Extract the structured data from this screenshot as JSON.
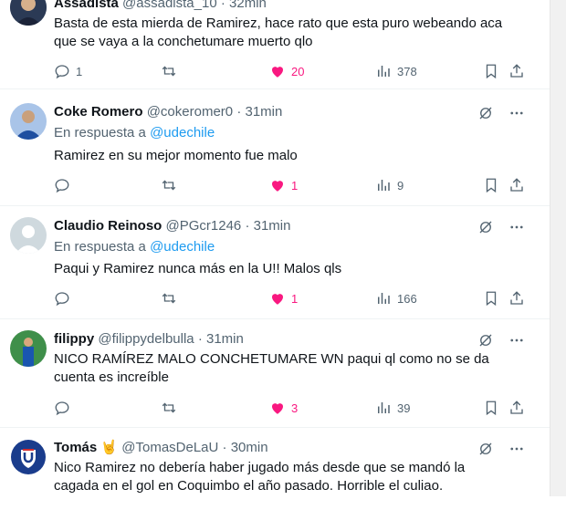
{
  "tweets": [
    {
      "name": "Assadista",
      "handle": "@assadista_10",
      "time": "32min",
      "reply_prefix": "",
      "reply_to": "",
      "text": "Basta de esta mierda de Ramirez, hace rato que esta puro webeando aca que se vaya a la conchetumare muerto qlo",
      "replies": "1",
      "retweets": "",
      "likes": "20",
      "views": "378",
      "liked": true,
      "avatar_color": "#2b3a55"
    },
    {
      "name": "Coke Romero",
      "handle": "@cokeromer0",
      "time": "31min",
      "reply_prefix": "En respuesta a",
      "reply_to": "@udechile",
      "text": "Ramirez en su mejor momento fue malo",
      "replies": "",
      "retweets": "",
      "likes": "1",
      "views": "9",
      "liked": true,
      "avatar_color": "#1f4fa0"
    },
    {
      "name": "Claudio Reinoso",
      "handle": "@PGcr1246",
      "time": "31min",
      "reply_prefix": "En respuesta a",
      "reply_to": "@udechile",
      "text": "Paqui y Ramirez nunca más en la U!! Malos qls",
      "replies": "",
      "retweets": "",
      "likes": "1",
      "views": "166",
      "liked": true,
      "avatar_color": "#cfd9de"
    },
    {
      "name": "filippy",
      "handle": "@filippydelbulla",
      "time": "31min",
      "reply_prefix": "",
      "reply_to": "",
      "text": "NICO RAMÍREZ MALO CONCHETUMARE WN paqui ql como no se da cuenta es increíble",
      "replies": "",
      "retweets": "",
      "likes": "3",
      "views": "39",
      "liked": true,
      "avatar_color": "#2f7d3a"
    },
    {
      "name": "Tomás 🤘",
      "handle": "@TomasDeLaU",
      "time": "30min",
      "reply_prefix": "",
      "reply_to": "",
      "text": "Nico Ramirez no debería haber jugado más desde que se mandó la cagada en el gol en Coquimbo el año pasado. Horrible el culiao.",
      "replies": "",
      "retweets": "",
      "likes": "",
      "views": "",
      "liked": false,
      "avatar_color": "#1a3c8c"
    }
  ],
  "colors": {
    "like": "#f91880",
    "link": "#1d9bf0",
    "muted": "#536471",
    "text": "#0f1419"
  }
}
